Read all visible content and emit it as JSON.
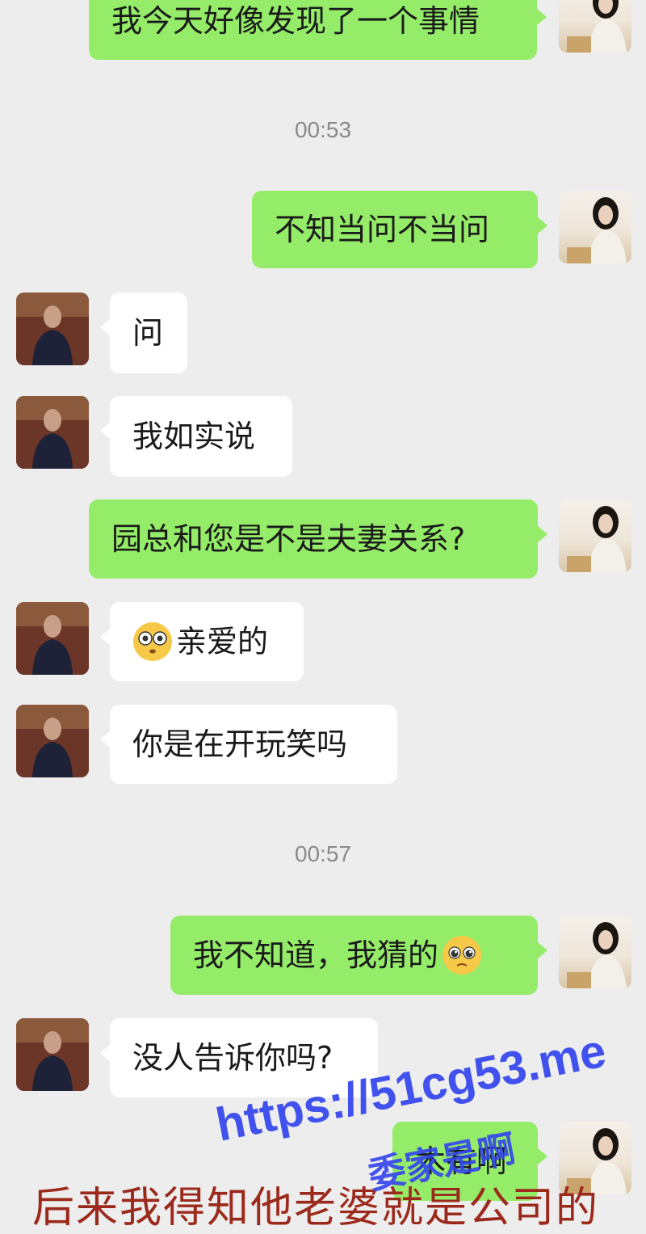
{
  "timestamps": [
    "00:53",
    "00:57"
  ],
  "messages": [
    {
      "side": "me",
      "text": "我今天好像发现了一个事情"
    },
    {
      "side": "me",
      "text": "不知当问不当问"
    },
    {
      "side": "other",
      "text": "问"
    },
    {
      "side": "other",
      "text": "我如实说"
    },
    {
      "side": "me",
      "text": "园总和您是不是夫妻关系?"
    },
    {
      "side": "other",
      "text": "亲爱的",
      "emoji": "flushed-face-icon"
    },
    {
      "side": "other",
      "text": "你是在开玩笑吗"
    },
    {
      "side": "me",
      "text": "我不知道，我猜的",
      "emoji": "pleading-face-icon"
    },
    {
      "side": "other",
      "text": "没人告诉你吗?"
    },
    {
      "side": "me",
      "text": "木有啊"
    }
  ],
  "caption": "后来我得知他老婆就是公司的",
  "watermark": {
    "url": "https://51cg53.me",
    "sub": "委家是啊"
  },
  "colors": {
    "me_bubble": "#95ec69",
    "other_bubble": "#ffffff",
    "background": "#ededed"
  }
}
